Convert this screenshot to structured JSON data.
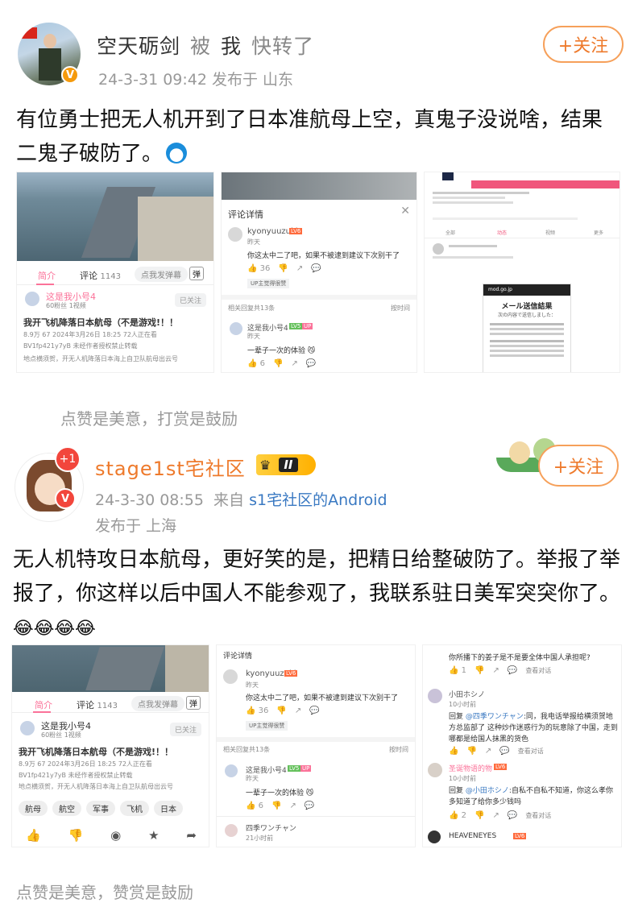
{
  "post1": {
    "author": "空天砺剑",
    "action_by": "被",
    "action_me": "我",
    "action_verb": "快转了",
    "meta": "24-3-31 09:42 发布于 山东",
    "follow_label": "+关注",
    "text": "有位勇士把无人机开到了日本准航母上空，真鬼子没说啥，结果二鬼子破防了。",
    "tip": "点赞是美意，打赏是鼓励"
  },
  "post2": {
    "author": "stage1st宅社区",
    "level": "II",
    "plus_badge": "+1",
    "meta1": "24-3-30 08:55",
    "from_label": "来自",
    "source": "s1宅社区的Android",
    "meta2": "发布于 上海",
    "follow_label": "+关注",
    "text": "无人机特攻日本航母，更好笑的是，把精日给整破防了。举报了举报了，你这样以后中国人不能参观了，我联系驻日美军突突你了。",
    "emoji": "😂😂😂😂",
    "tip": "点赞是美意，赞赏是鼓励"
  },
  "bili": {
    "tab_intro": "简介",
    "tab_comments": "评论",
    "comment_count": "1143",
    "danmaku_placeholder": "点我发弹幕",
    "danmaku_btn": "弹",
    "uploader": "这是我小号4",
    "uploader_meta": "60粉丝 1视频",
    "followed": "已关注",
    "video_title": "我开飞机降落日本航母（不是游戏!！！",
    "stats": "8.9万  67  2024年3月26日 18:25  72人正在看",
    "bv": "BV1fp421y7yB  未经作者授权禁止转载",
    "desc": "地点横须贺，开无人机降落日本海上自卫队航母出云号",
    "tags": [
      "航母",
      "航空",
      "军事",
      "飞机",
      "日本"
    ]
  },
  "comments": {
    "header": "评论详情",
    "u1": "kyonyuuzuki",
    "u1_level": "LV6",
    "u1_time": "昨天",
    "u1_text": "你这太中二了吧，如果不被逮到建议下次别干了",
    "u1_likes": "36",
    "up_liked": "UP主觉得很赞",
    "reply_header": "相关回复共13条",
    "sort": "按时间",
    "u2": "这是我小号4",
    "u2_level": "LV5",
    "u2_up": "UP",
    "u2_time": "昨天",
    "u2_text": "一辈子一次的体验",
    "u2_likes": "6",
    "u3": "四季ワンチャン",
    "u3_time": "21小时前"
  },
  "twitter": {
    "menu_title": "メール送信結果",
    "menu_sub": "次の内容で送信しました：",
    "url": "mod.go.jp",
    "tab_a": "全部",
    "tab_b": "动态",
    "tab_c": "视频",
    "tab_d": "更多"
  },
  "thread": {
    "top_text": "你所播下的姜子是不是要全体中国人承担呢?",
    "top_likes": "1",
    "reply_label": "回复",
    "see_reply": "查看对话",
    "c1_user": "小田ホシノ",
    "c1_time": "10小时前",
    "c1_mention": "@四季ワンチャン",
    "c1_text": ":同，我电话举报给横须贺地方总监部了 这种炒作迷惑行为的玩意除了中国，走到哪都是给国人抹黑的货色",
    "c2_user": "圣诞物语的物",
    "c2_level": "LV6",
    "c2_time": "10小时前",
    "c2_mention": "@小田ホシノ",
    "c2_text": ":自私不自私不知道，你这么孝你多知道了给你多少钱吗",
    "c2_likes": "2",
    "c3_user": "HEAVENEYES",
    "c3_level": "LV6"
  }
}
